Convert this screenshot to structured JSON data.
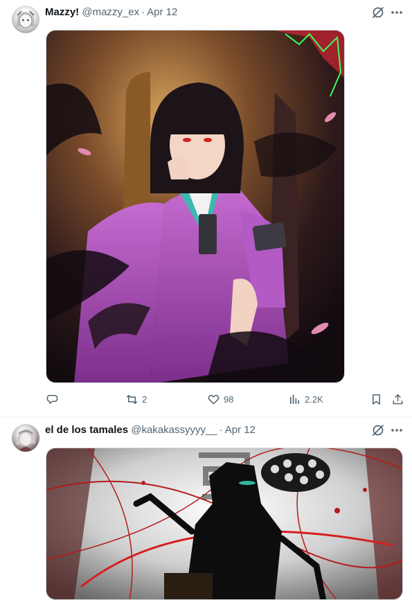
{
  "tweets": [
    {
      "author_name": "Mazzy!",
      "handle": "@mazzy_ex",
      "separator": "·",
      "time": "Apr 12",
      "media_alt": "Anime illustration of a dark-haired girl in a pink fur-trimmed coat sitting on a throne",
      "actions": {
        "reply_count": "",
        "retweet_count": "2",
        "like_count": "98",
        "views_count": "2.2K"
      }
    },
    {
      "author_name": "el de los tamales",
      "handle": "@kakakassyyyy__",
      "separator": "·",
      "time": "Apr 12",
      "media_alt": "Monochrome illustration of a dark figure on a chair with red threads"
    }
  ],
  "icons": {
    "grok": "grok-icon",
    "more": "more-icon",
    "reply": "reply-icon",
    "retweet": "retweet-icon",
    "like": "like-icon",
    "views": "views-icon",
    "bookmark": "bookmark-icon",
    "share": "share-icon"
  },
  "colors": {
    "text": "#0f1419",
    "secondary": "#536471",
    "border": "#eff3f4"
  }
}
